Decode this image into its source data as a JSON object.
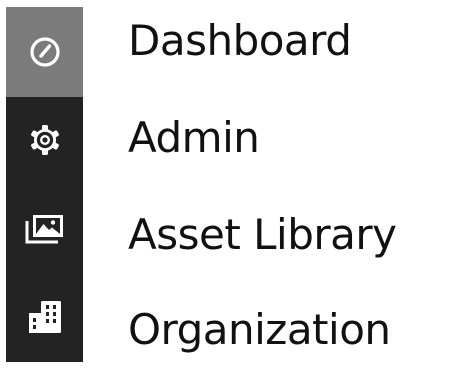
{
  "nav": {
    "items": [
      {
        "label": "Dashboard",
        "icon": "gauge-icon",
        "active": true
      },
      {
        "label": "Admin",
        "icon": "gear-icon",
        "active": false
      },
      {
        "label": "Asset Library",
        "icon": "images-icon",
        "active": false
      },
      {
        "label": "Organization",
        "icon": "building-icon",
        "active": false
      }
    ]
  },
  "colors": {
    "rail_background": "#232323",
    "active_background": "#7b7b7b",
    "icon_color": "#ffffff",
    "label_color": "#111111"
  }
}
